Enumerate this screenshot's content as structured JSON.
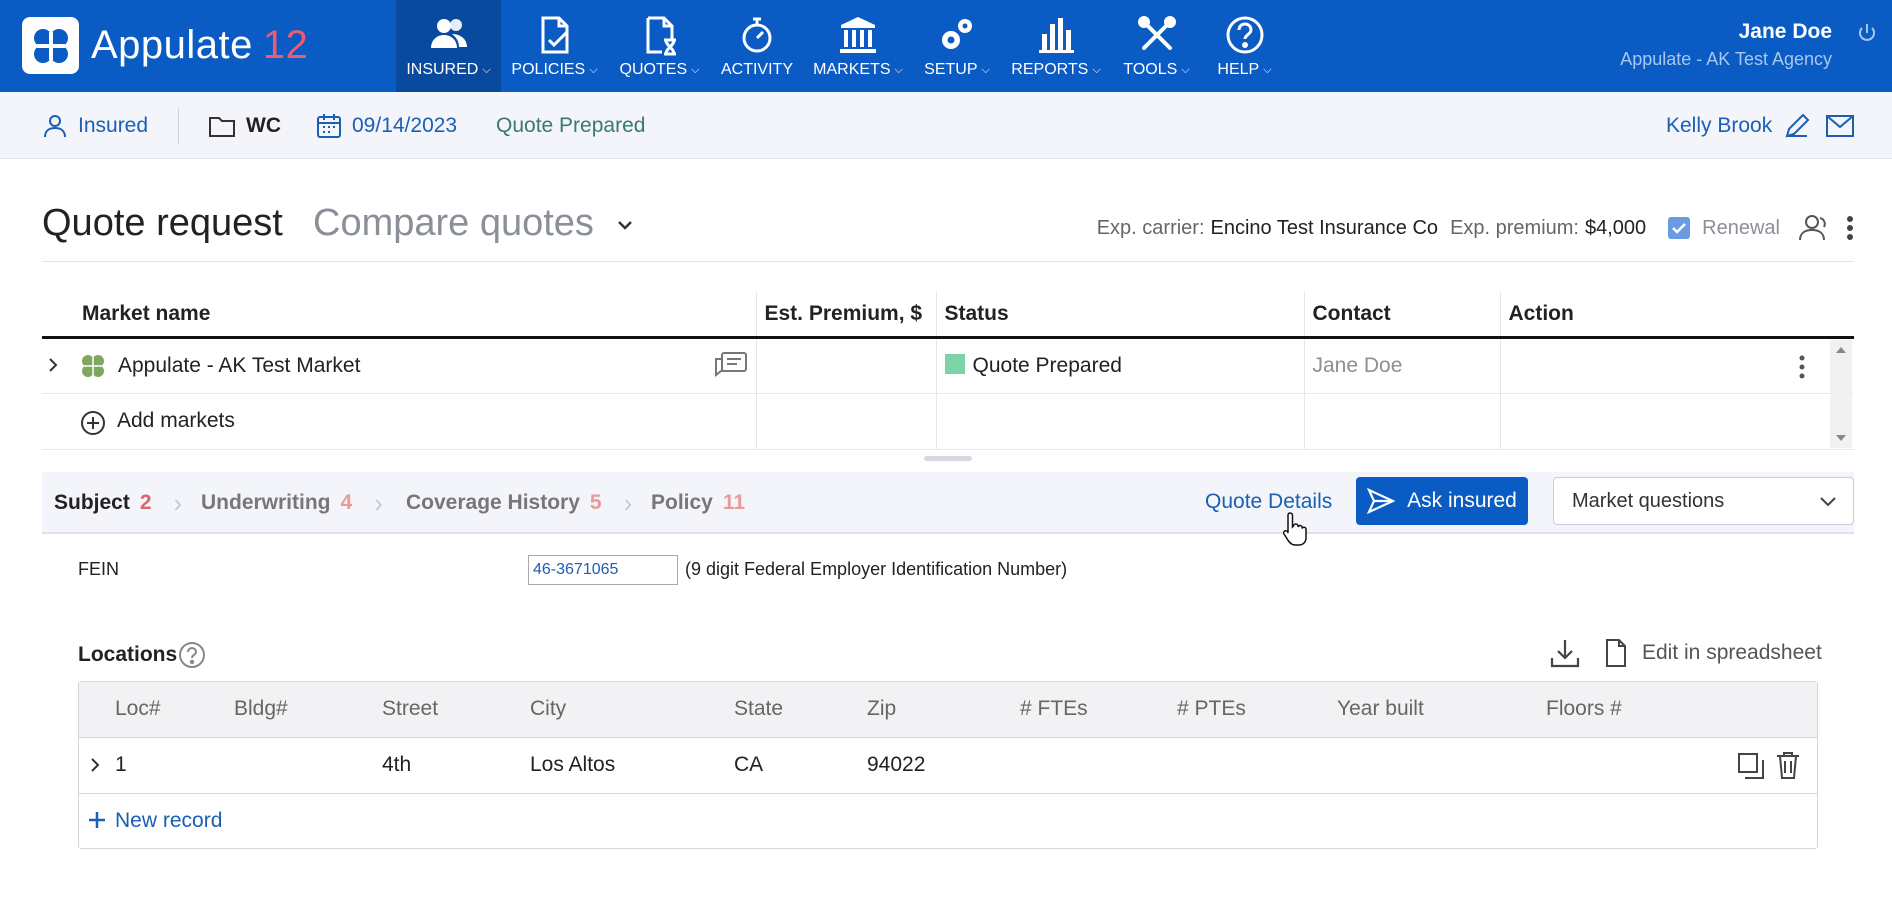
{
  "app": {
    "name": "Appulate",
    "version": "12"
  },
  "nav": [
    {
      "label": "INSURED",
      "icon": "users-icon",
      "active": true
    },
    {
      "label": "POLICIES",
      "icon": "document-check-icon"
    },
    {
      "label": "QUOTES",
      "icon": "document-hourglass-icon"
    },
    {
      "label": "ACTIVITY",
      "icon": "stopwatch-icon"
    },
    {
      "label": "MARKETS",
      "icon": "bank-icon"
    },
    {
      "label": "SETUP",
      "icon": "gears-icon"
    },
    {
      "label": "REPORTS",
      "icon": "bar-chart-icon"
    },
    {
      "label": "TOOLS",
      "icon": "tools-icon"
    },
    {
      "label": "HELP",
      "icon": "question-icon"
    }
  ],
  "user": {
    "name": "Jane Doe",
    "agency": "Appulate - AK Test Agency"
  },
  "subbar": {
    "insured": "Insured",
    "lob": "WC",
    "date": "09/14/2023",
    "status": "Quote Prepared",
    "contact": "Kelly Brook"
  },
  "header": {
    "title": "Quote request",
    "compare": "Compare quotes",
    "exp_carrier_label": "Exp. carrier:",
    "exp_carrier": "Encino Test Insurance Co",
    "exp_premium_label": "Exp. premium:",
    "exp_premium": "$4,000",
    "renewal": "Renewal"
  },
  "markets": {
    "columns": [
      "Market name",
      "Est. Premium, $",
      "Status",
      "Contact",
      "Action"
    ],
    "rows": [
      {
        "name": "Appulate - AK Test Market",
        "premium": "",
        "status": "Quote Prepared",
        "contact": "Jane Doe"
      }
    ],
    "add": "Add markets"
  },
  "tabs": [
    {
      "label": "Subject",
      "count": "2",
      "active": true
    },
    {
      "label": "Underwriting",
      "count": "4"
    },
    {
      "label": "Coverage History",
      "count": "5"
    },
    {
      "label": "Policy",
      "count": "11"
    }
  ],
  "actions": {
    "quote_details": "Quote Details",
    "ask_insured": "Ask insured",
    "market_questions": "Market questions"
  },
  "fein": {
    "label": "FEIN",
    "value": "46-3671065",
    "hint": "(9 digit Federal Employer Identification Number)"
  },
  "locations": {
    "title": "Locations",
    "edit": "Edit in spreadsheet",
    "columns": [
      "Loc#",
      "Bldg#",
      "Street",
      "City",
      "State",
      "Zip",
      "# FTEs",
      "# PTEs",
      "Year built",
      "Floors #"
    ],
    "rows": [
      {
        "loc": "1",
        "bldg": "",
        "street": "4th",
        "city": "Los Altos",
        "state": "CA",
        "zip": "94022"
      }
    ],
    "new": "New record"
  },
  "colors": {
    "brand": "#0a5bc4",
    "accent_red": "#ef5a6f",
    "status_green": "#7bd3a7"
  }
}
